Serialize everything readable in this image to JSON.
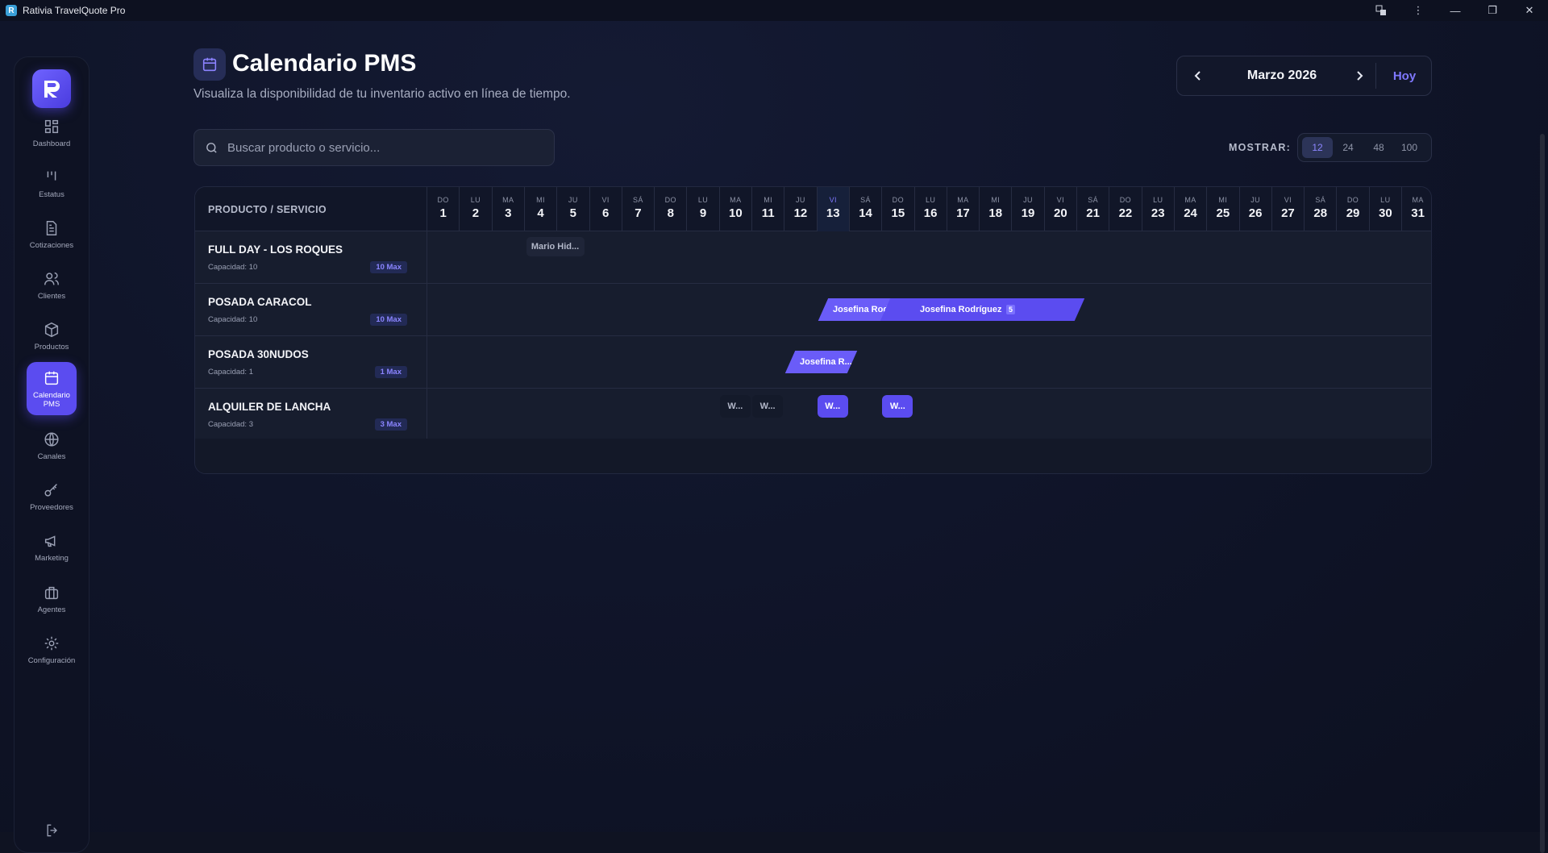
{
  "window": {
    "title": "Rativia TravelQuote Pro"
  },
  "sidebar": {
    "items": [
      {
        "label": "Dashboard",
        "icon": "grid-icon"
      },
      {
        "label": "Estatus",
        "icon": "bars-icon"
      },
      {
        "label": "Cotizaciones",
        "icon": "document-icon"
      },
      {
        "label": "Clientes",
        "icon": "users-icon"
      },
      {
        "label": "Productos",
        "icon": "box-icon"
      },
      {
        "label": "Calendario PMS",
        "icon": "calendar-icon",
        "active": true
      },
      {
        "label": "Canales",
        "icon": "globe-icon"
      },
      {
        "label": "Proveedores",
        "icon": "key-icon"
      },
      {
        "label": "Marketing",
        "icon": "megaphone-icon"
      },
      {
        "label": "Agentes",
        "icon": "briefcase-icon"
      },
      {
        "label": "Configuración",
        "icon": "gear-icon"
      }
    ]
  },
  "header": {
    "title": "Calendario PMS",
    "subtitle": "Visualiza la disponibilidad de tu inventario activo en línea de tiempo."
  },
  "month_nav": {
    "month": "Marzo 2026",
    "today_label": "Hoy"
  },
  "search": {
    "placeholder": "Buscar producto o servicio..."
  },
  "show": {
    "label": "MOSTRAR:",
    "options": [
      "12",
      "24",
      "48",
      "100"
    ],
    "selected": "12"
  },
  "calendar": {
    "product_header": "PRODUCTO / SERVICIO",
    "today_day": 13,
    "days": [
      {
        "dw": "DO",
        "dn": "1"
      },
      {
        "dw": "LU",
        "dn": "2"
      },
      {
        "dw": "MA",
        "dn": "3"
      },
      {
        "dw": "MI",
        "dn": "4"
      },
      {
        "dw": "JU",
        "dn": "5"
      },
      {
        "dw": "VI",
        "dn": "6"
      },
      {
        "dw": "SÁ",
        "dn": "7"
      },
      {
        "dw": "DO",
        "dn": "8"
      },
      {
        "dw": "LU",
        "dn": "9"
      },
      {
        "dw": "MA",
        "dn": "10"
      },
      {
        "dw": "MI",
        "dn": "11"
      },
      {
        "dw": "JU",
        "dn": "12"
      },
      {
        "dw": "VI",
        "dn": "13"
      },
      {
        "dw": "SÁ",
        "dn": "14"
      },
      {
        "dw": "DO",
        "dn": "15"
      },
      {
        "dw": "LU",
        "dn": "16"
      },
      {
        "dw": "MA",
        "dn": "17"
      },
      {
        "dw": "MI",
        "dn": "18"
      },
      {
        "dw": "JU",
        "dn": "19"
      },
      {
        "dw": "VI",
        "dn": "20"
      },
      {
        "dw": "SÁ",
        "dn": "21"
      },
      {
        "dw": "DO",
        "dn": "22"
      },
      {
        "dw": "LU",
        "dn": "23"
      },
      {
        "dw": "MA",
        "dn": "24"
      },
      {
        "dw": "MI",
        "dn": "25"
      },
      {
        "dw": "JU",
        "dn": "26"
      },
      {
        "dw": "VI",
        "dn": "27"
      },
      {
        "dw": "SÁ",
        "dn": "28"
      },
      {
        "dw": "DO",
        "dn": "29"
      },
      {
        "dw": "LU",
        "dn": "30"
      },
      {
        "dw": "MA",
        "dn": "31"
      }
    ],
    "rows": [
      {
        "name": "FULL DAY - LOS ROQUES",
        "capacity": "Capacidad: 10",
        "max": "10 Max",
        "bookings": [
          {
            "label": "Mario Hid...",
            "style": "ghost",
            "start": 4,
            "end": 5
          }
        ]
      },
      {
        "name": "POSADA CARACOL",
        "capacity": "Capacidad: 10",
        "max": "10 Max",
        "bookings": [
          {
            "label": "Josefina Rodríguez",
            "style": "para",
            "start": 13,
            "end": 20,
            "count": "5"
          },
          {
            "label": "Josefina Rodrig",
            "style": "para",
            "start": 13,
            "end": 14
          }
        ]
      },
      {
        "name": "POSADA 30NUDOS",
        "capacity": "Capacidad: 1",
        "max": "1 Max",
        "bookings": [
          {
            "label": "Josefina R...",
            "style": "para",
            "start": 12,
            "end": 13
          }
        ]
      },
      {
        "name": "ALQUILER DE LANCHA",
        "capacity": "Capacidad: 3",
        "max": "3 Max",
        "bookings": [
          {
            "label": "W...",
            "style": "ghost-dark",
            "start": 10,
            "end": 10
          },
          {
            "label": "W...",
            "style": "ghost-dark",
            "start": 11,
            "end": 11
          },
          {
            "label": "W...",
            "style": "box",
            "start": 13,
            "end": 13
          },
          {
            "label": "W...",
            "style": "box",
            "start": 15,
            "end": 15
          }
        ]
      }
    ]
  },
  "colors": {
    "accent": "#5b4cf0",
    "accent_text": "#7f78ff",
    "background": "#0f1322"
  }
}
